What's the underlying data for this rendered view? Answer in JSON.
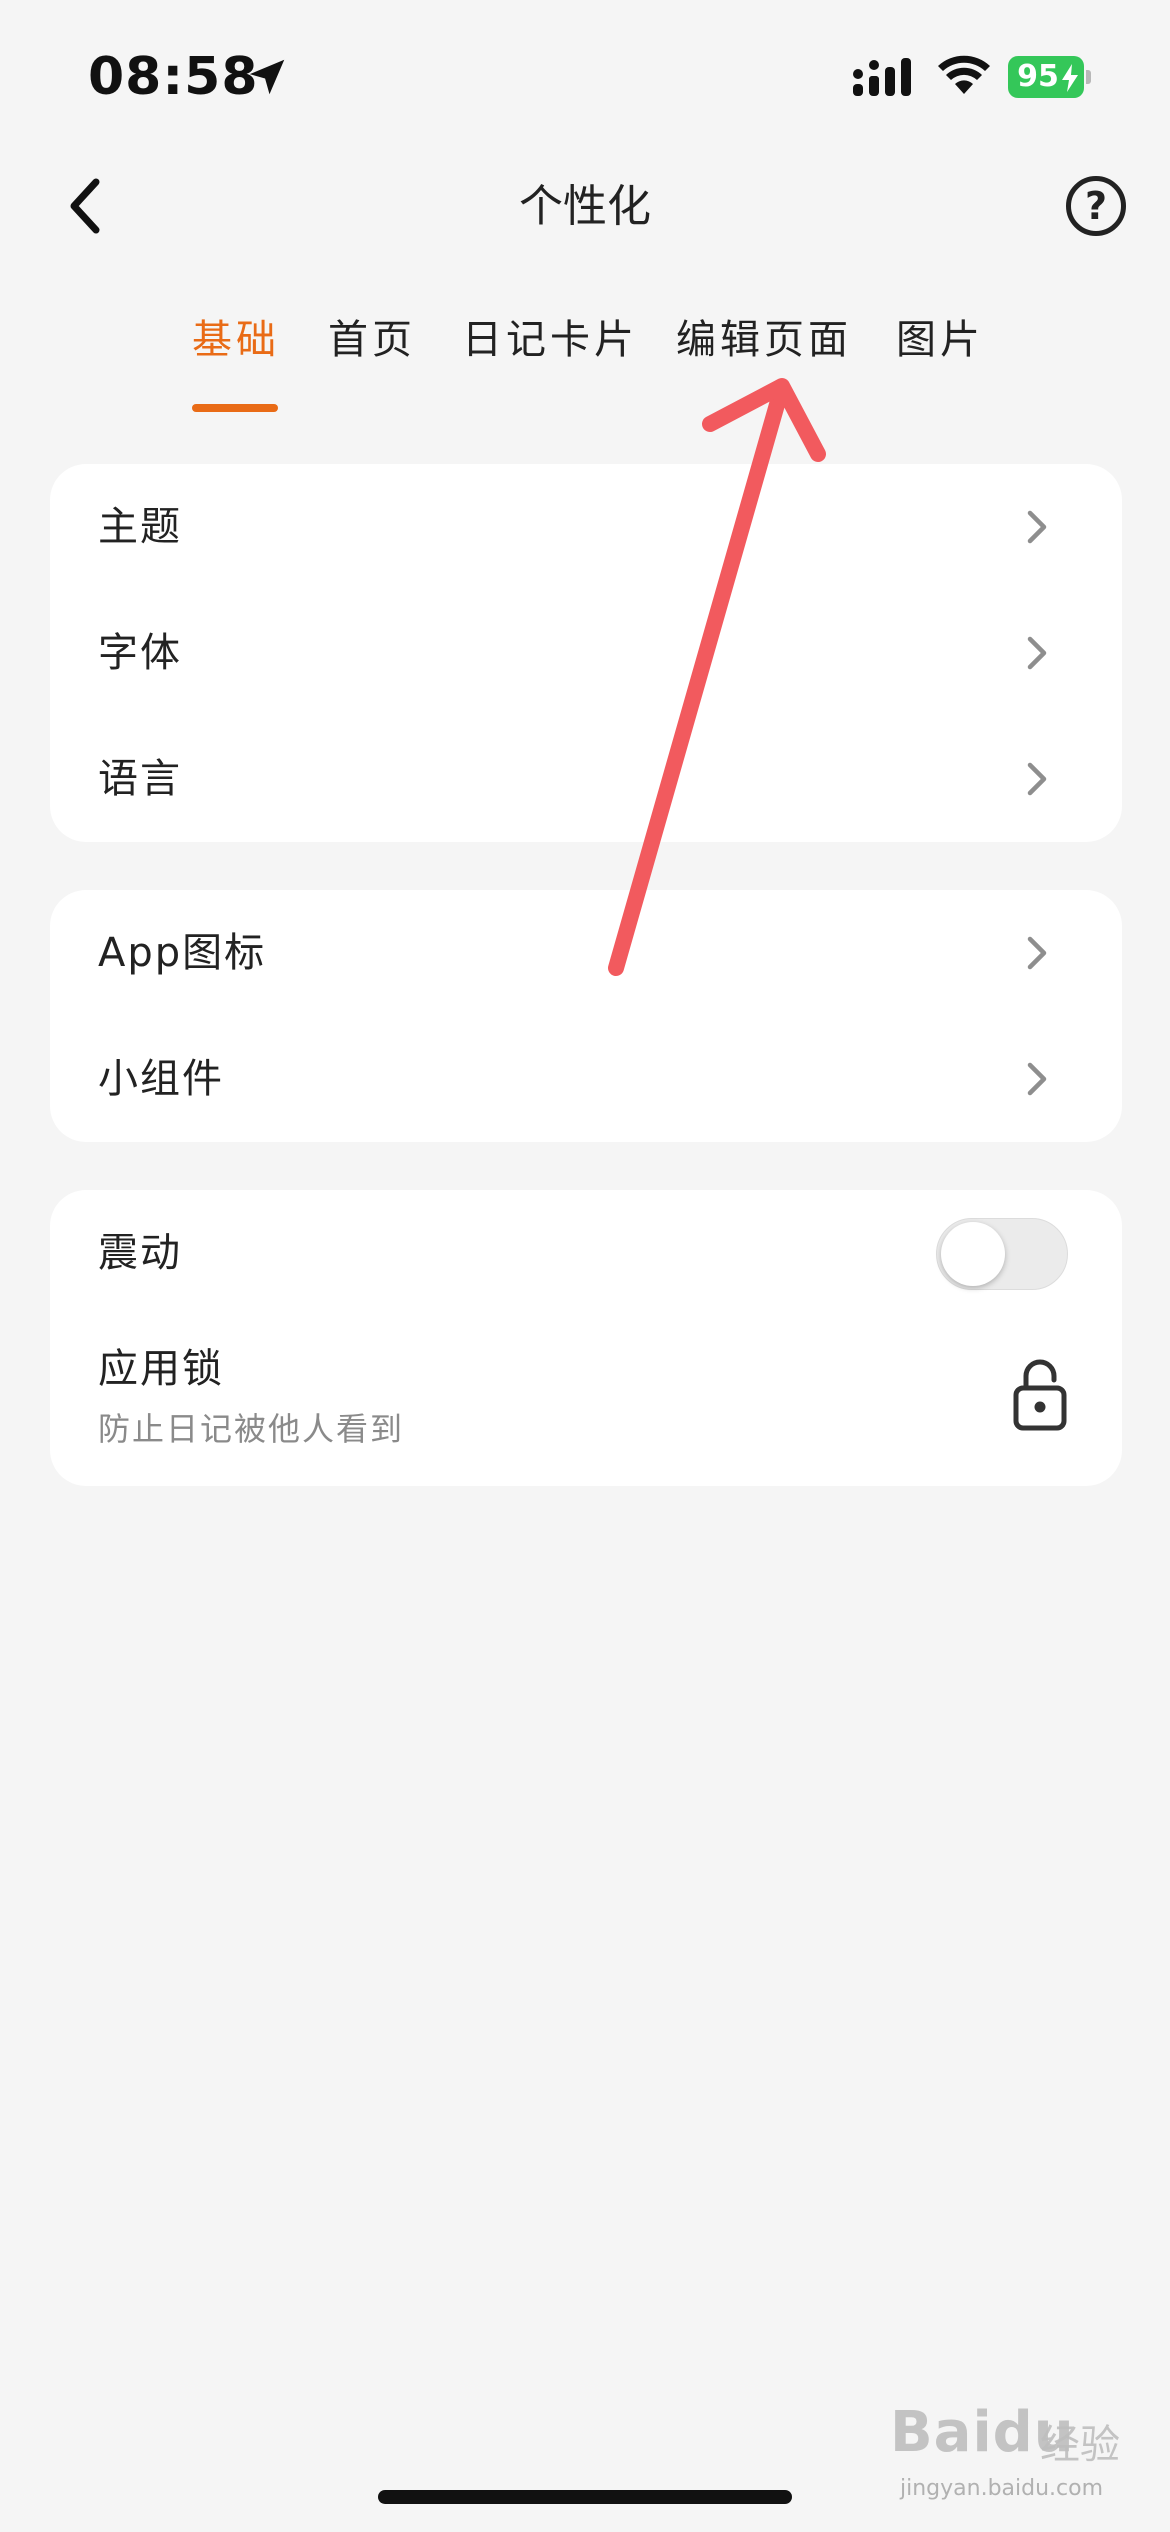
{
  "status_bar": {
    "time": "08:58",
    "battery_level": "95",
    "battery_color": "#34c759"
  },
  "nav": {
    "title": "个性化",
    "back_icon": "chevron-left-icon",
    "help_label": "?"
  },
  "tabs": {
    "active_index": 0,
    "accent_color": "#e96b16",
    "items": [
      {
        "label": "基础"
      },
      {
        "label": "首页"
      },
      {
        "label": "日记卡片"
      },
      {
        "label": "编辑页面"
      },
      {
        "label": "图片"
      }
    ]
  },
  "groups": {
    "basic": {
      "items": [
        {
          "label": "主题"
        },
        {
          "label": "字体"
        },
        {
          "label": "语言"
        }
      ]
    },
    "appearance": {
      "items": [
        {
          "label": "App图标"
        },
        {
          "label": "小组件"
        }
      ]
    },
    "system": {
      "vibration": {
        "label": "震动",
        "enabled": false
      },
      "app_lock": {
        "label": "应用锁",
        "subtitle": "防止日记被他人看到",
        "icon": "lock-icon"
      }
    }
  },
  "annotation": {
    "color": "#f25a5e"
  },
  "watermark": {
    "logo": "Baidu",
    "cn": "经验",
    "url": "jingyan.baidu.com"
  }
}
